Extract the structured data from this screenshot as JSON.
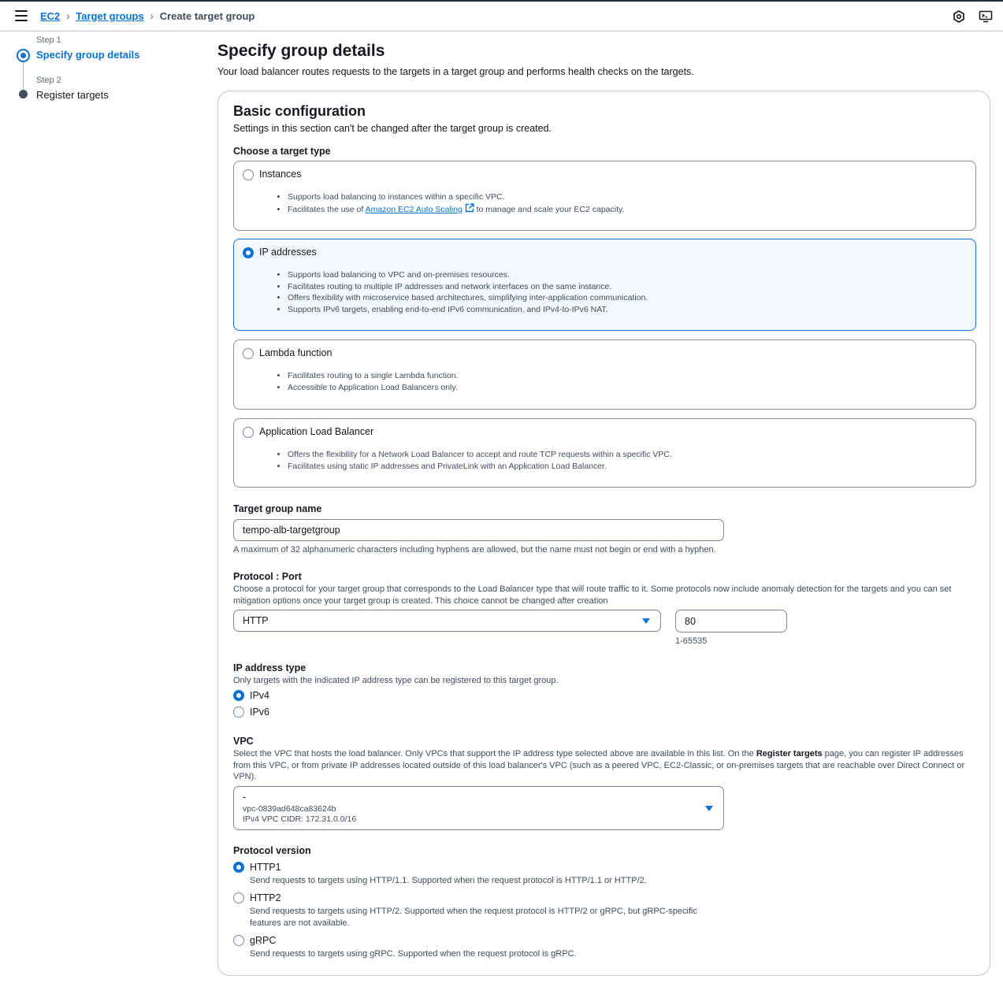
{
  "breadcrumb": {
    "items": [
      "EC2",
      "Target groups"
    ],
    "current": "Create target group"
  },
  "steps": [
    {
      "label": "Step 1",
      "title": "Specify group details",
      "active": true
    },
    {
      "label": "Step 2",
      "title": "Register targets",
      "active": false
    }
  ],
  "page": {
    "title": "Specify group details",
    "description": "Your load balancer routes requests to the targets in a target group and performs health checks on the targets."
  },
  "basic": {
    "title": "Basic configuration",
    "description": "Settings in this section can't be changed after the target group is created.",
    "target_type_label": "Choose a target type",
    "target_types": [
      {
        "label": "Instances",
        "bullets": [
          "Supports load balancing to instances within a specific VPC."
        ],
        "bullet2_prefix": "Facilitates the use of ",
        "bullet2_link": "Amazon EC2 Auto Scaling",
        "bullet2_suffix": " to manage and scale your EC2 capacity."
      },
      {
        "label": "IP addresses",
        "selected": true,
        "bullets": [
          "Supports load balancing to VPC and on-premises resources.",
          "Facilitates routing to multiple IP addresses and network interfaces on the same instance.",
          "Offers flexibility with microservice based architectures, simplifying inter-application communication.",
          "Supports IPv6 targets, enabling end-to-end IPv6 communication, and IPv4-to-IPv6 NAT."
        ]
      },
      {
        "label": "Lambda function",
        "bullets": [
          "Facilitates routing to a single Lambda function.",
          "Accessible to Application Load Balancers only."
        ]
      },
      {
        "label": "Application Load Balancer",
        "bullets": [
          "Offers the flexibility for a Network Load Balancer to accept and route TCP requests within a specific VPC.",
          "Facilitates using static IP addresses and PrivateLink with an Application Load Balancer."
        ]
      }
    ],
    "name_label": "Target group name",
    "name_value": "tempo-alb-targetgroup",
    "name_hint": "A maximum of 32 alphanumeric characters including hyphens are allowed, but the name must not begin or end with a hyphen.",
    "protocol_label": "Protocol : Port",
    "protocol_desc": "Choose a protocol for your target group that corresponds to the Load Balancer type that will route traffic to it. Some protocols now include anomaly detection for the targets and you can set mitigation options once your target group is created. This choice cannot be changed after creation",
    "protocol_value": "HTTP",
    "port_value": "80",
    "port_hint": "1-65535",
    "ip_type_label": "IP address type",
    "ip_type_desc": "Only targets with the indicated IP address type can be registered to this target group.",
    "ip_types": [
      {
        "label": "IPv4",
        "selected": true
      },
      {
        "label": "IPv6",
        "selected": false
      }
    ],
    "vpc_label": "VPC",
    "vpc_desc_prefix": "Select the VPC that hosts the load balancer. Only VPCs that support the IP address type selected above are available in this list. On the ",
    "vpc_desc_bold": "Register targets",
    "vpc_desc_suffix": " page, you can register IP addresses from this VPC, or from private IP addresses located outside of this load balancer's VPC (such as a peered VPC, EC2-Classic, or on-premises targets that are reachable over Direct Connect or VPN).",
    "vpc_name": "-",
    "vpc_id": "vpc-0839ad648ca83624b",
    "vpc_cidr": "IPv4 VPC CIDR: 172.31.0.0/16",
    "protocol_version_label": "Protocol version",
    "protocol_versions": [
      {
        "label": "HTTP1",
        "selected": true,
        "desc": "Send requests to targets using HTTP/1.1. Supported when the request protocol is HTTP/1.1 or HTTP/2."
      },
      {
        "label": "HTTP2",
        "selected": false,
        "desc": "Send requests to targets using HTTP/2. Supported when the request protocol is HTTP/2 or gRPC, but gRPC-specific features are not available."
      },
      {
        "label": "gRPC",
        "selected": false,
        "desc": "Send requests to targets using gRPC. Supported when the request protocol is gRPC."
      }
    ]
  },
  "colors": {
    "accent": "#0972d3",
    "selected_bg": "#f2f8fd",
    "border": "#8c8c94",
    "text": "#16191f"
  },
  "icons": [
    "menu-icon",
    "chevron-right-icon",
    "notifications-icon",
    "cloudshell-icon",
    "external-link-icon",
    "caret-down-icon"
  ]
}
